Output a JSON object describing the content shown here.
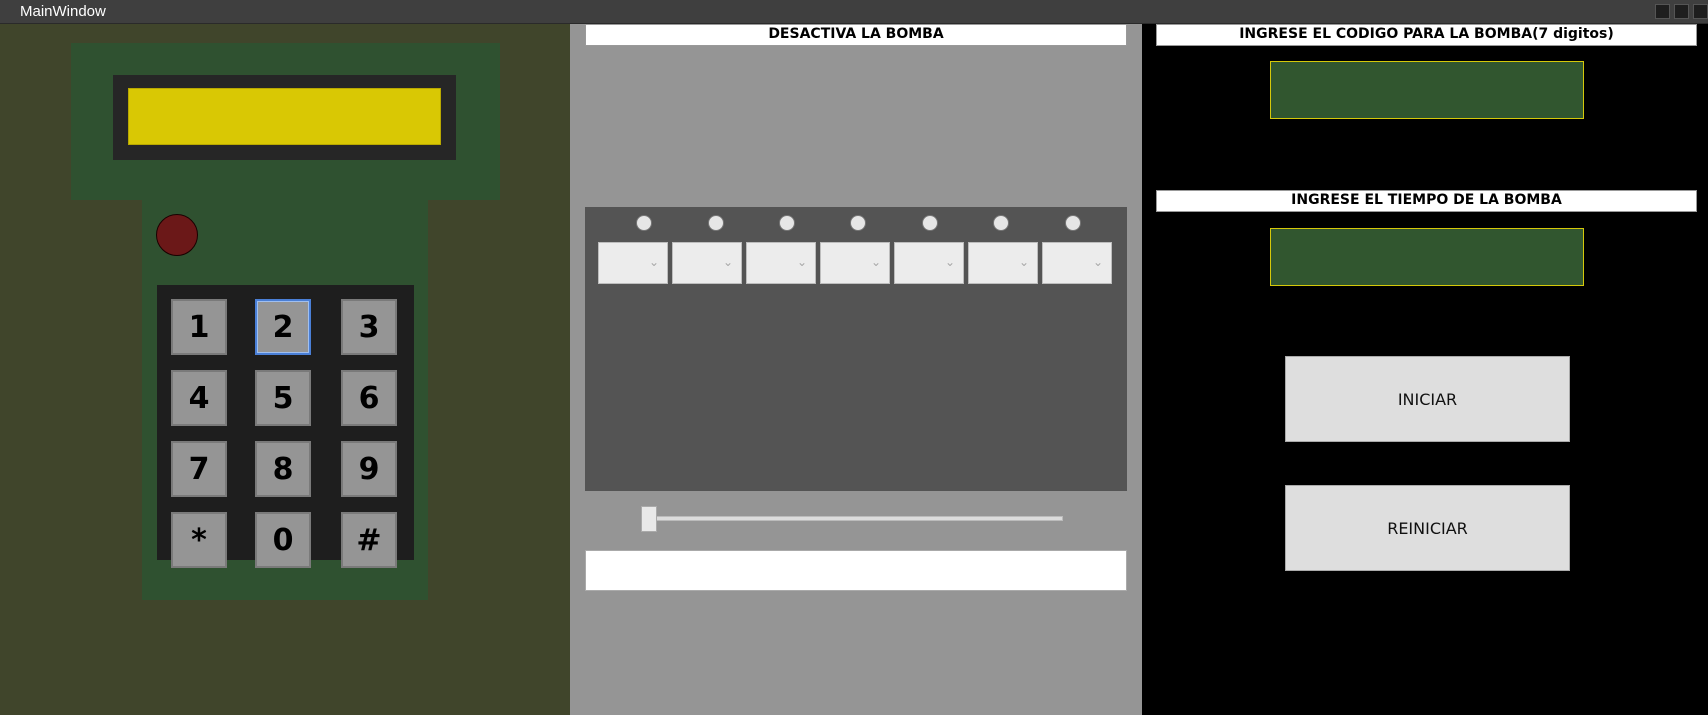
{
  "window": {
    "title": "MainWindow"
  },
  "keypad": {
    "keys": [
      "1",
      "2",
      "3",
      "4",
      "5",
      "6",
      "7",
      "8",
      "9",
      "*",
      "0",
      "#"
    ],
    "focused_key": "2",
    "lcd_color": "#d9c804",
    "led_color": "#6b1818"
  },
  "middle": {
    "header": "DESACTIVA LA BOMBA",
    "wire_count": 7,
    "slider_value": 0
  },
  "right": {
    "code_header": "INGRESE EL CODIGO PARA LA BOMBA(7 digitos)",
    "time_header": "INGRESE EL TIEMPO DE LA BOMBA",
    "start_label": "INICIAR",
    "reset_label": "REINICIAR"
  },
  "colors": {
    "left_bg": "#40452b",
    "device_green": "#2f5130",
    "mid_bg": "#959595",
    "right_bg": "#000000",
    "input_border": "#d5c80a"
  }
}
